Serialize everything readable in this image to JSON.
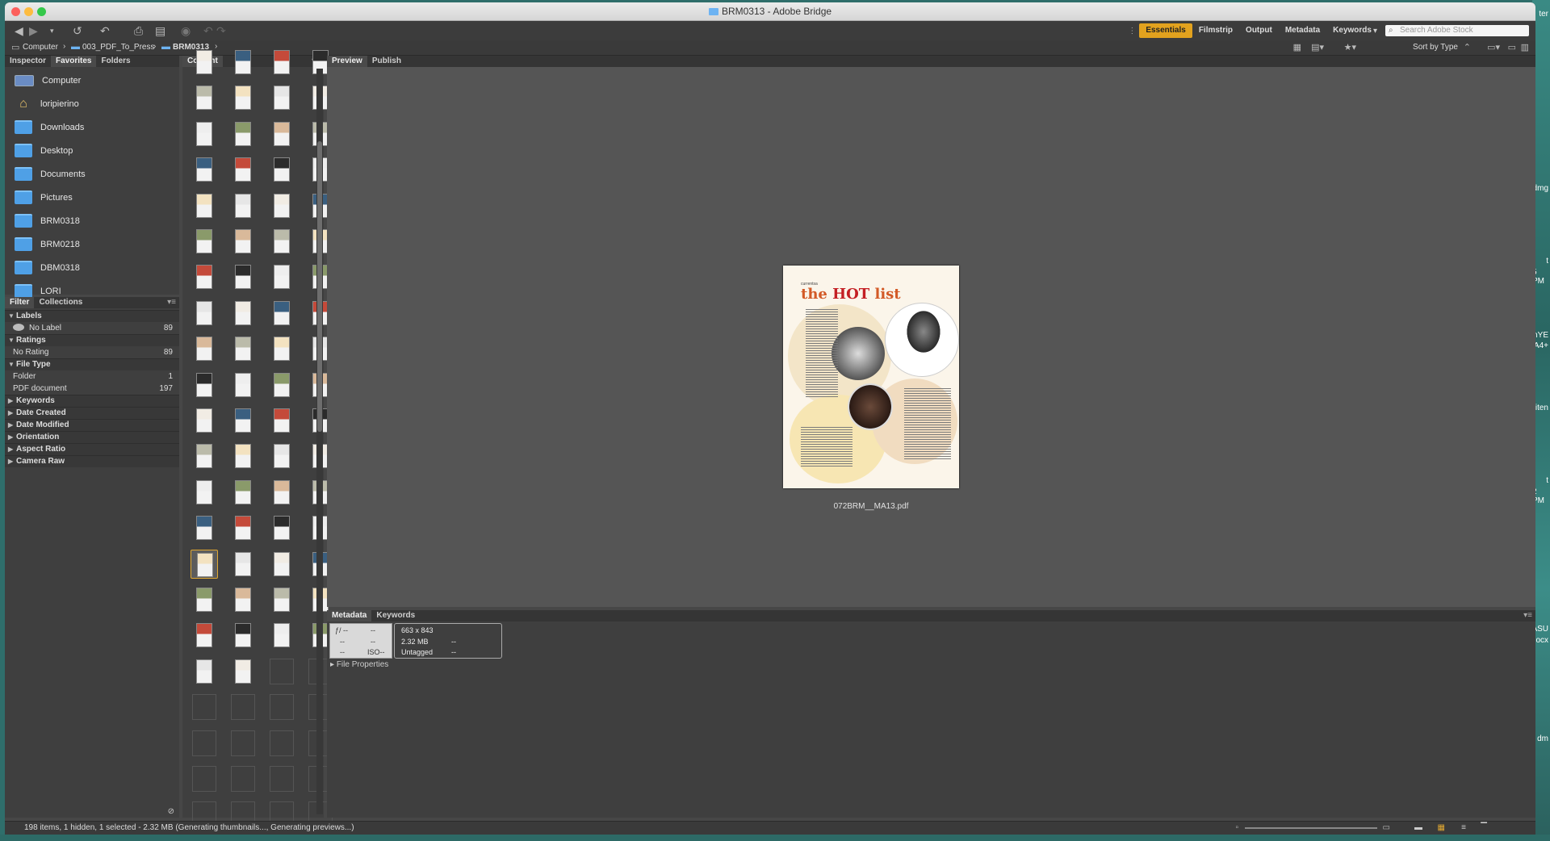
{
  "window": {
    "title": "BRM0313 - Adobe Bridge"
  },
  "workspaces": [
    "Essentials",
    "Filmstrip",
    "Output",
    "Metadata",
    "Keywords"
  ],
  "workspace_dropdown": "▾",
  "search": {
    "placeholder": "Search Adobe Stock"
  },
  "path": [
    "Computer",
    "003_PDF_To_Press",
    "BRM0313"
  ],
  "sort_label": "Sort by Type",
  "left_tabs": [
    "Inspector",
    "Favorites",
    "Folders"
  ],
  "favorites": [
    {
      "label": "Computer",
      "icon": "computer"
    },
    {
      "label": "loripierino",
      "icon": "home"
    },
    {
      "label": "Downloads",
      "icon": "folder"
    },
    {
      "label": "Desktop",
      "icon": "folder"
    },
    {
      "label": "Documents",
      "icon": "folder"
    },
    {
      "label": "Pictures",
      "icon": "folder"
    },
    {
      "label": "BRM0318",
      "icon": "folder"
    },
    {
      "label": "BRM0218",
      "icon": "folder"
    },
    {
      "label": "DBM0318",
      "icon": "folder"
    },
    {
      "label": "LORI",
      "icon": "folder"
    }
  ],
  "filter_tabs": [
    "Filter",
    "Collections"
  ],
  "filters": {
    "labels": {
      "title": "Labels",
      "rows": [
        {
          "label": "No Label",
          "count": "89"
        }
      ]
    },
    "ratings": {
      "title": "Ratings",
      "rows": [
        {
          "label": "No Rating",
          "count": "89"
        }
      ]
    },
    "filetype": {
      "title": "File Type",
      "rows": [
        {
          "label": "Folder",
          "count": "1"
        },
        {
          "label": "PDF document",
          "count": "197"
        }
      ]
    },
    "collapsed": [
      "Keywords",
      "Date Created",
      "Date Modified",
      "Orientation",
      "Aspect Ratio",
      "Camera Raw"
    ]
  },
  "content_tab": "Content",
  "preview_tabs": [
    "Preview",
    "Publish"
  ],
  "preview": {
    "filename": "072BRM__MA13.pdf",
    "kicker": "currentsa",
    "headline_pre": "the ",
    "headline_hot": "HOT",
    "headline_post": " list"
  },
  "metadata_tabs": [
    "Metadata",
    "Keywords"
  ],
  "metadata": {
    "camera": [
      "ƒ/ --",
      "--",
      "--",
      "--",
      "--",
      "ISO--"
    ],
    "dimensions": "663 x 843",
    "size": "2.32 MB",
    "profile": "Untagged",
    "dash1": "--",
    "dash2": "--",
    "section": "File Properties"
  },
  "status": "198 items, 1 hidden, 1 selected - 2.32 MB (Generating thumbnails..., Generating previews...)",
  "desktop_labels": [
    "ter",
    "dmg",
    "t",
    "5 PM",
    "anYE",
    "A4+",
    "iten",
    "t",
    "2 PM",
    "ASU",
    "ocx",
    "dm"
  ]
}
